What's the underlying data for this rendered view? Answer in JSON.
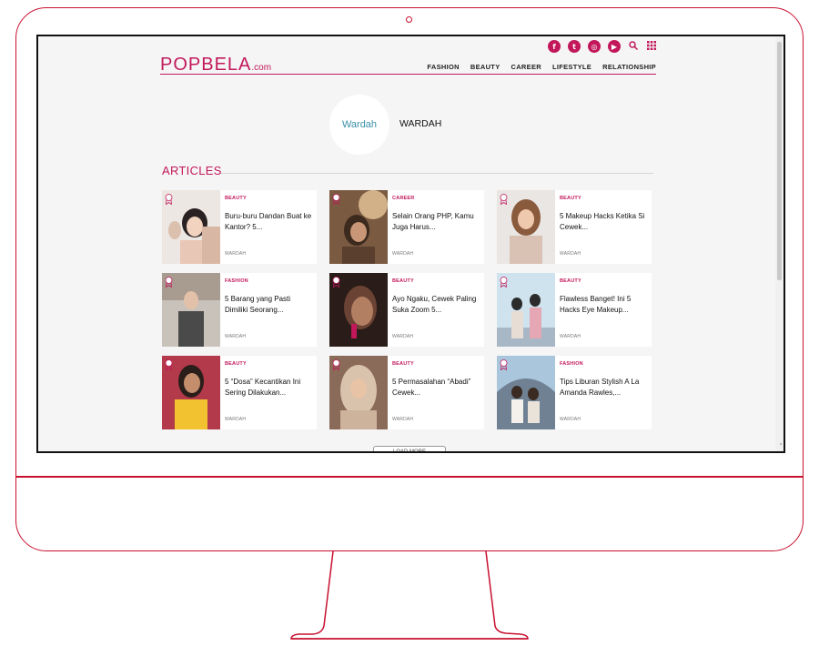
{
  "header": {
    "logo_main": "POPBELA",
    "logo_suffix": ".com",
    "socials": [
      {
        "name": "facebook-icon",
        "glyph": "f"
      },
      {
        "name": "twitter-icon",
        "glyph": "t"
      },
      {
        "name": "instagram-icon",
        "glyph": "◎"
      },
      {
        "name": "youtube-icon",
        "glyph": "▶"
      }
    ],
    "nav": [
      "FASHION",
      "BEAUTY",
      "CAREER",
      "LIFESTYLE",
      "RELATIONSHIP"
    ]
  },
  "brand": {
    "logo_text": "Wardah",
    "name": "WARDAH"
  },
  "articles": {
    "heading": "ARTICLES",
    "items": [
      {
        "category": "BEAUTY",
        "title": "Buru-buru Dandan Buat ke Kantor? 5...",
        "author": "WARDAH"
      },
      {
        "category": "CAREER",
        "title": "Selain Orang PHP, Kamu Juga Harus...",
        "author": "WARDAH"
      },
      {
        "category": "BEAUTY",
        "title": "5 Makeup Hacks Ketika Si Cewek...",
        "author": "WARDAH"
      },
      {
        "category": "FASHION",
        "title": "5 Barang yang Pasti Dimiliki Seorang...",
        "author": "WARDAH"
      },
      {
        "category": "BEAUTY",
        "title": "Ayo Ngaku, Cewek Paling Suka Zoom 5...",
        "author": "WARDAH"
      },
      {
        "category": "BEAUTY",
        "title": "Flawless Banget! Ini 5 Hacks Eye Makeup...",
        "author": "WARDAH"
      },
      {
        "category": "BEAUTY",
        "title": "5 “Dosa” Kecantikan Ini Sering Dilakukan...",
        "author": "WARDAH"
      },
      {
        "category": "BEAUTY",
        "title": "5 Permasalahan “Abadi” Cewek...",
        "author": "WARDAH"
      },
      {
        "category": "FASHION",
        "title": "Tips Liburan Stylish A La Amanda Rawles,...",
        "author": "WARDAH"
      }
    ]
  },
  "load_more": "LOAD MORE",
  "colors": {
    "accent": "#c2185b",
    "frame": "#c8102e"
  }
}
